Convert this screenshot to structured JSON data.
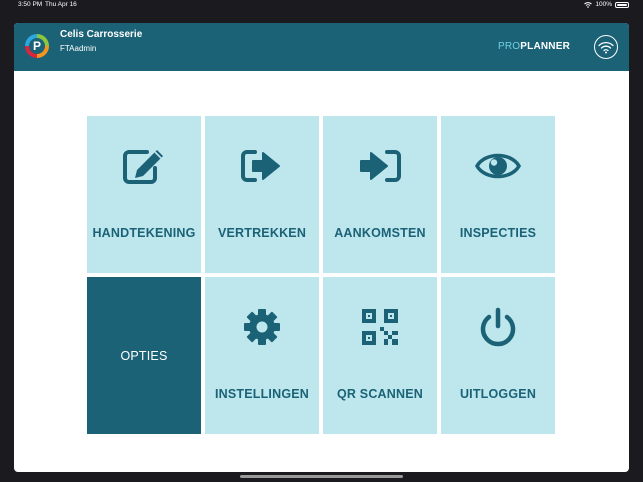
{
  "status_bar": {
    "time": "3:50 PM",
    "date": "Thu Apr 16",
    "battery": "100%"
  },
  "header": {
    "logo_letter": "P",
    "company": "Celis Carrosserie",
    "user": "FTAadmin",
    "brand_pro": "PRO",
    "brand_planner": "PLANNER",
    "background": "#1b6277"
  },
  "tiles": [
    {
      "label": "HANDTEKENING",
      "icon": "edit-icon"
    },
    {
      "label": "VERTREKKEN",
      "icon": "sign-out-icon"
    },
    {
      "label": "AANKOMSTEN",
      "icon": "sign-in-icon"
    },
    {
      "label": "INSPECTIES",
      "icon": "eye-icon"
    },
    {
      "label": "OPTIES",
      "icon": null,
      "selected": true
    },
    {
      "label": "INSTELLINGEN",
      "icon": "gear-icon"
    },
    {
      "label": "QR SCANNEN",
      "icon": "qr-code-icon"
    },
    {
      "label": "UITLOGGEN",
      "icon": "power-icon"
    }
  ],
  "colors": {
    "tile": "#bde6ed",
    "tile_selected": "#1b6277",
    "text": "#1b6277"
  }
}
